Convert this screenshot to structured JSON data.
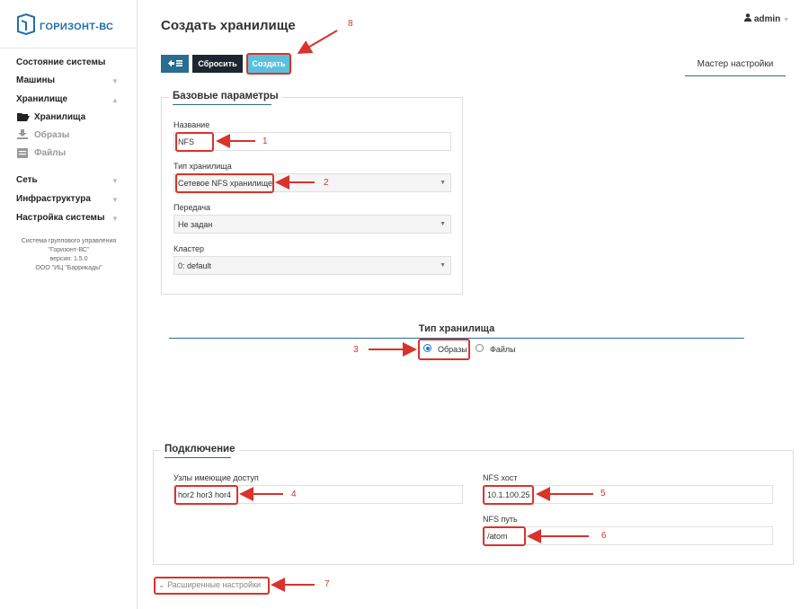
{
  "sidebar": {
    "logo_text": "ГОРИЗОНТ-ВС",
    "items": [
      {
        "label": "Состояние системы"
      },
      {
        "label": "Машины"
      },
      {
        "label": "Хранилище"
      },
      {
        "label": "Сеть"
      },
      {
        "label": "Инфраструктура"
      },
      {
        "label": "Настройка системы"
      }
    ],
    "sub_items": [
      {
        "label": "Хранилища",
        "icon": "folder-open-icon",
        "active": true
      },
      {
        "label": "Образы",
        "icon": "download-icon",
        "active": false
      },
      {
        "label": "Файлы",
        "icon": "file-icon",
        "active": false
      }
    ],
    "sys_info": [
      "Система группового управления",
      "\"Горизонт-ВС\"",
      "версия: 1.5.0",
      "ООО \"ИЦ \"Баррикады\""
    ]
  },
  "header": {
    "title": "Создать хранилище",
    "user": "admin",
    "user_icon": "user-icon"
  },
  "toolbar": {
    "back_icon": "arrow-left-list-icon",
    "reset_label": "Сбросить",
    "create_label": "Создать",
    "wizard_tab": "Мастер настройки"
  },
  "basic": {
    "title": "Базовые параметры",
    "name_label": "Название",
    "name_value": "NFS",
    "type_label": "Тип хранилища",
    "type_value": "Сетевое NFS хранилище",
    "transfer_label": "Передача",
    "transfer_value": "Не задан",
    "cluster_label": "Кластер",
    "cluster_value": "0: default"
  },
  "storage_type": {
    "title": "Тип хранилища",
    "option_images": "Образы",
    "option_files": "Файлы",
    "selected": "Образы"
  },
  "connection": {
    "title": "Подключение",
    "nodes_label": "Узлы имеющие доступ",
    "nodes_value": "hor2 hor3 hor4",
    "host_label": "NFS хост",
    "host_value": "10.1.100.25",
    "path_label": "NFS путь",
    "path_value": "/atom"
  },
  "advanced_label": "Расширенные настройки",
  "annotations": [
    "1",
    "2",
    "3",
    "4",
    "5",
    "6",
    "7",
    "8"
  ],
  "colors": {
    "accent": "#1f6fa8",
    "dark": "#1b2631",
    "create": "#5bc0de",
    "annotation": "#d9332b"
  }
}
